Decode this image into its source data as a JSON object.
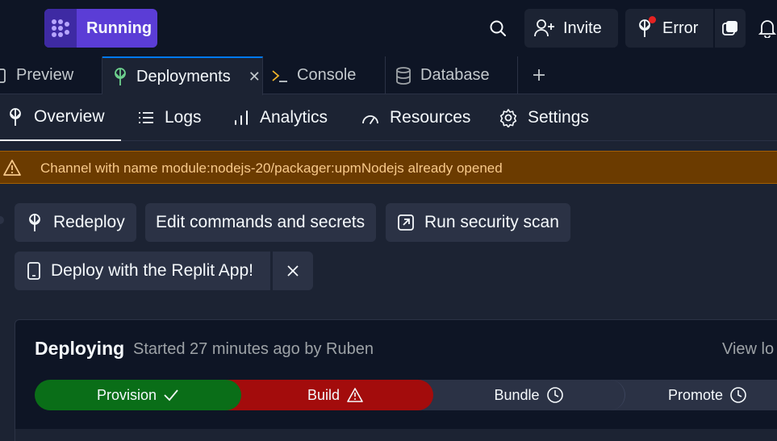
{
  "topbar": {
    "run_label": "Running",
    "invite_label": "Invite",
    "error_label": "Error"
  },
  "tabs": [
    {
      "label": "Preview"
    },
    {
      "label": "Deployments"
    },
    {
      "label": "Console"
    },
    {
      "label": "Database"
    }
  ],
  "subnav": [
    {
      "label": "Overview"
    },
    {
      "label": "Logs"
    },
    {
      "label": "Analytics"
    },
    {
      "label": "Resources"
    },
    {
      "label": "Settings"
    }
  ],
  "warning": {
    "text": "Channel with name module:nodejs-20/packager:upmNodejs already opened"
  },
  "actions": {
    "redeploy": "Redeploy",
    "edit": "Edit commands and secrets",
    "scan": "Run security scan",
    "app": "Deploy with the Replit App!"
  },
  "deployment": {
    "status": "Deploying",
    "meta": "Started 27 minutes ago by Ruben",
    "view_link": "View lo",
    "stages": [
      {
        "label": "Provision",
        "state": "done",
        "color": "#0a6e18"
      },
      {
        "label": "Build",
        "state": "error",
        "color": "#a30c0c"
      },
      {
        "label": "Bundle",
        "state": "pending",
        "color": "#2b3245"
      },
      {
        "label": "Promote",
        "state": "pending",
        "color": "#2b3245"
      }
    ]
  },
  "colors": {
    "accent": "#5b3dd6",
    "background": "#1c2333",
    "surface": "#0e1525",
    "warning_bg": "#6b3b00",
    "success": "#0a6e18",
    "error": "#a30c0c"
  }
}
